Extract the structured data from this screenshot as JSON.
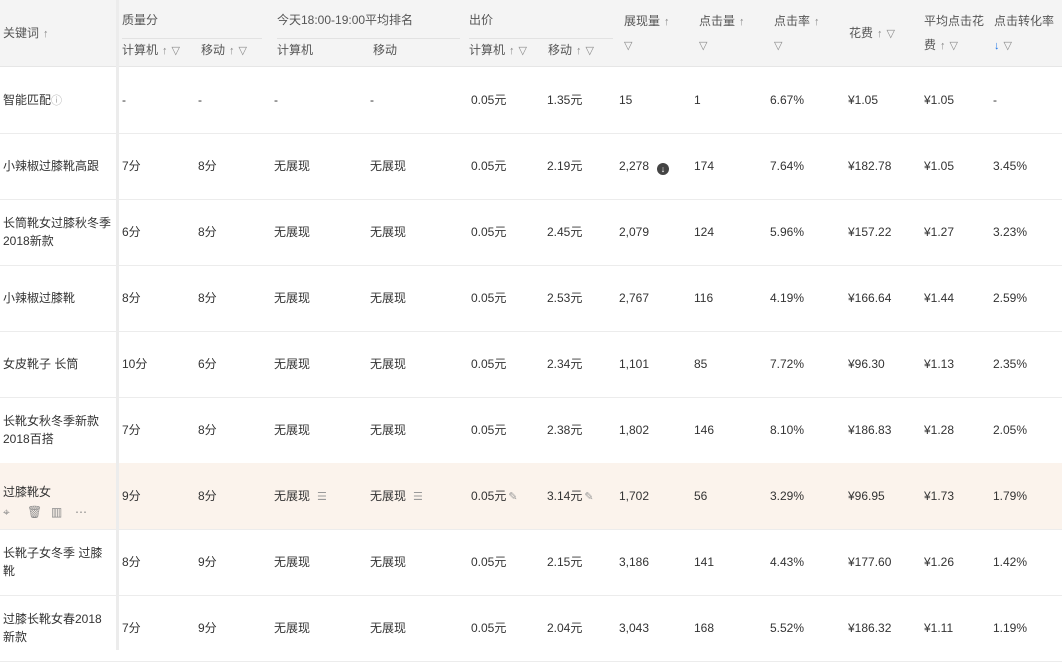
{
  "columns": {
    "keyword": "关键词",
    "quality": "质量分",
    "quality_pc": "计算机",
    "quality_mobile": "移动",
    "rank": "今天18:00-19:00平均排名",
    "rank_pc": "计算机",
    "rank_mobile": "移动",
    "bid": "出价",
    "bid_pc": "计算机",
    "bid_mobile": "移动",
    "impressions": "展现量",
    "clicks": "点击量",
    "ctr": "点击率",
    "cost": "花费",
    "avg_cpc_line1": "平均点击花",
    "avg_cpc_line2": "费",
    "conv_rate": "点击转化率"
  },
  "icons": {
    "sort": "sort-arrow-icon",
    "filter": "filter-icon",
    "sort_active_color": "#1a73e8"
  },
  "rows": [
    {
      "keyword": "智能匹配",
      "qpc": "-",
      "qmob": "-",
      "rpc": "-",
      "rmob": "-",
      "bpc": "0.05元",
      "bmob": "1.35元",
      "imp": "15",
      "clk": "1",
      "ctr": "6.67%",
      "cost": "¥1.05",
      "cpc": "¥1.05",
      "conv": "-"
    },
    {
      "keyword": "小辣椒过膝靴高跟",
      "qpc": "7分",
      "qmob": "8分",
      "rpc": "无展现",
      "rmob": "无展现",
      "bpc": "0.05元",
      "bmob": "2.19元",
      "imp": "2,278",
      "clk": "174",
      "ctr": "7.64%",
      "cost": "¥182.78",
      "cpc": "¥1.05",
      "conv": "3.45%"
    },
    {
      "keyword": "长筒靴女过膝秋冬季2018新款",
      "qpc": "6分",
      "qmob": "8分",
      "rpc": "无展现",
      "rmob": "无展现",
      "bpc": "0.05元",
      "bmob": "2.45元",
      "imp": "2,079",
      "clk": "124",
      "ctr": "5.96%",
      "cost": "¥157.22",
      "cpc": "¥1.27",
      "conv": "3.23%"
    },
    {
      "keyword": "小辣椒过膝靴",
      "qpc": "8分",
      "qmob": "8分",
      "rpc": "无展现",
      "rmob": "无展现",
      "bpc": "0.05元",
      "bmob": "2.53元",
      "imp": "2,767",
      "clk": "116",
      "ctr": "4.19%",
      "cost": "¥166.64",
      "cpc": "¥1.44",
      "conv": "2.59%"
    },
    {
      "keyword": "女皮靴子 长筒",
      "qpc": "10分",
      "qmob": "6分",
      "rpc": "无展现",
      "rmob": "无展现",
      "bpc": "0.05元",
      "bmob": "2.34元",
      "imp": "1,101",
      "clk": "85",
      "ctr": "7.72%",
      "cost": "¥96.30",
      "cpc": "¥1.13",
      "conv": "2.35%"
    },
    {
      "keyword": "长靴女秋冬季新款2018百搭",
      "qpc": "7分",
      "qmob": "8分",
      "rpc": "无展现",
      "rmob": "无展现",
      "bpc": "0.05元",
      "bmob": "2.38元",
      "imp": "1,802",
      "clk": "146",
      "ctr": "8.10%",
      "cost": "¥186.83",
      "cpc": "¥1.28",
      "conv": "2.05%"
    },
    {
      "keyword": "过膝靴女",
      "qpc": "9分",
      "qmob": "8分",
      "rpc": "无展现",
      "rmob": "无展现",
      "bpc": "0.05元",
      "bmob": "3.14元",
      "imp": "1,702",
      "clk": "56",
      "ctr": "3.29%",
      "cost": "¥96.95",
      "cpc": "¥1.73",
      "conv": "1.79%"
    },
    {
      "keyword": "长靴子女冬季 过膝靴",
      "qpc": "8分",
      "qmob": "9分",
      "rpc": "无展现",
      "rmob": "无展现",
      "bpc": "0.05元",
      "bmob": "2.15元",
      "imp": "3,186",
      "clk": "141",
      "ctr": "4.43%",
      "cost": "¥177.60",
      "cpc": "¥1.26",
      "conv": "1.42%"
    },
    {
      "keyword": "过膝长靴女春2018新款",
      "qpc": "7分",
      "qmob": "9分",
      "rpc": "无展现",
      "rmob": "无展现",
      "bpc": "0.05元",
      "bmob": "2.04元",
      "imp": "3,043",
      "clk": "168",
      "ctr": "5.52%",
      "cost": "¥186.32",
      "cpc": "¥1.11",
      "conv": "1.19%"
    }
  ],
  "row_tools": [
    "target-icon",
    "trash-icon",
    "report-icon",
    "more-icon"
  ],
  "colors": {
    "highlight_row": "#fbf3ec",
    "header_bg": "#f4f4f4"
  }
}
